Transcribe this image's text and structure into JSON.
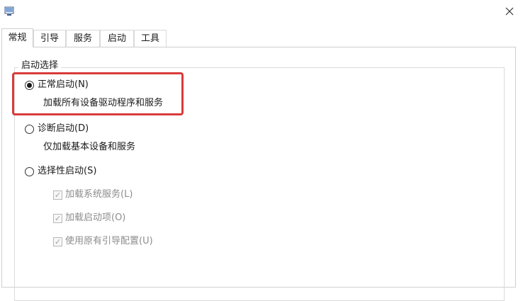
{
  "window": {
    "icon": "system-config-icon",
    "close_icon": "close-icon"
  },
  "tabs": [
    {
      "label": "常规",
      "active": true
    },
    {
      "label": "引导",
      "active": false
    },
    {
      "label": "服务",
      "active": false
    },
    {
      "label": "启动",
      "active": false
    },
    {
      "label": "工具",
      "active": false
    }
  ],
  "startup_selection": {
    "legend": "启动选择",
    "options": [
      {
        "label": "正常启动(N)",
        "description": "加载所有设备驱动程序和服务",
        "selected": true
      },
      {
        "label": "诊断启动(D)",
        "description": "仅加载基本设备和服务",
        "selected": false
      },
      {
        "label": "选择性启动(S)",
        "selected": false
      }
    ],
    "selective_items": [
      {
        "label": "加载系统服务(L)",
        "checked": true,
        "enabled": false
      },
      {
        "label": "加载启动项(O)",
        "checked": true,
        "enabled": false
      },
      {
        "label": "使用原有引导配置(U)",
        "checked": true,
        "enabled": false
      }
    ]
  },
  "highlight": {
    "color": "#d83b3b"
  }
}
